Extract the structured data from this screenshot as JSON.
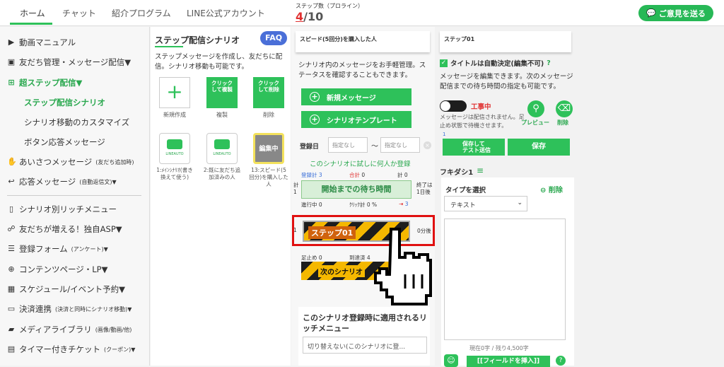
{
  "top_nav": [
    "ホーム",
    "チャット",
    "紹介プログラム",
    "LINE公式アカウント"
  ],
  "step_count": {
    "label": "ステップ数（プロライン）",
    "current": "4",
    "sep": "/",
    "max": "10"
  },
  "feedback_label": "ご意見を送る",
  "sidebar": {
    "items": [
      {
        "label": "動画マニュアル",
        "icon": "video-icon"
      },
      {
        "label": "友だち管理・メッセージ配信▼",
        "icon": "contact-icon"
      },
      {
        "label": "超ステップ配信▼",
        "icon": "hierarchy-icon"
      },
      {
        "label": "ステップ配信シナリオ"
      },
      {
        "label": "シナリオ移動のカスタマイズ"
      },
      {
        "label": "ボタン応答メッセージ"
      },
      {
        "label": "あいさつメッセージ",
        "sub": "(友だち追加時)",
        "icon": "hand-icon"
      },
      {
        "label": "応答メッセージ",
        "sub": "(自動返信文)▼",
        "icon": "reply-icon"
      },
      {
        "label": "シナリオ別リッチメニュー",
        "icon": "phone-icon"
      },
      {
        "label": "友だちが増える！独自ASP▼",
        "icon": "handshake-icon"
      },
      {
        "label": "登録フォーム",
        "sub": "(アンケート)▼",
        "icon": "list-icon"
      },
      {
        "label": "コンテンツページ・LP▼",
        "icon": "globe-icon"
      },
      {
        "label": "スケジュール/イベント予約▼",
        "icon": "calendar-icon"
      },
      {
        "label": "決済連携",
        "sub": "(決済と同時にシナリオ移動)▼",
        "icon": "card-icon"
      },
      {
        "label": "メディアライブラリ",
        "sub": "(画像/動画/他)",
        "icon": "folder-icon"
      },
      {
        "label": "タイマー付きチケット",
        "sub": "(クーポン)▼",
        "icon": "ticket-icon"
      }
    ]
  },
  "scenario": {
    "title": "ステップ配信シナリオ",
    "faq": "FAQ",
    "desc": "ステップメッセージを作成し、友だちに配信。シナリオ移動も可能です。",
    "actions": [
      {
        "btn": "+",
        "label": "新規作成"
      },
      {
        "btn": "クリック\nして複製",
        "label": "複製"
      },
      {
        "btn": "クリック\nして削除",
        "label": "削除"
      }
    ],
    "thumbs": [
      {
        "label": "1:ﾒｲﾝｼﾅﾘｵ(書き換えて使う)",
        "logo": "LINEAUTO"
      },
      {
        "label": "2:既に友だち追加済みの人",
        "logo": "LINEAUTO"
      },
      {
        "label": "13:スピード(5回分)を購入した人",
        "badge": "編集中"
      }
    ]
  },
  "middle": {
    "header": "スピード(5回分)を購入した人",
    "desc": "シナリオ内のメッセージをお手軽管理。ステータスを確認することもできます。",
    "new_msg": "新規メッセージ",
    "template": "シナリオテンプレート",
    "reg_date": "登録日",
    "date_from": "指定なし",
    "date_tilde": "〜",
    "date_to": "指定なし",
    "try_link": "このシナリオに試しに何人か登録",
    "stats1": {
      "reg": "登録計",
      "reg_n": "3",
      "total": "合計",
      "total_n": "0",
      "count": "計",
      "count_n": "0"
    },
    "side": {
      "kei": "計",
      "one": "1",
      "end": "終了は",
      "day": "1日後"
    },
    "wait_btn": "開始までの待ち時間",
    "stats2": {
      "prog": "進行中",
      "prog_n": "0",
      "click": "ｸﾘｯｸ計",
      "click_pct": "0 %",
      "moved_n": "3"
    },
    "step01": "ステップ01",
    "after": "0分後",
    "stats3": {
      "stop": "足止め",
      "stop_n": "0",
      "arrive": "到達済",
      "arrive_n": "4"
    },
    "next_scenario": "次のシナリオ",
    "rich_title": "このシナリオ登録時に適用されるリッチメニュー",
    "rich_select": "切り替えない(このシナリオに登..."
  },
  "right": {
    "header": "ステップ01",
    "title_auto": "タイトルは自動決定(編集不可)",
    "desc": "メッセージを編集できます。次のメッセージ配信までの待ち時間の指定も可能です。",
    "construction": "工事中",
    "note": "メッセージは配信されません。足止め状態で待機させます。",
    "preview": "プレビュー",
    "delete": "削除",
    "person_n": "1",
    "save_test": "保存して\nテスト送信",
    "save": "保存",
    "fukidashi": "フキダシ1",
    "type_label": "タイプを選択",
    "type_delete": "削除",
    "type_value": "テキスト",
    "count_text": "現在0字 / 残り4,500字",
    "field_btn": "[[フィールドを挿入]]"
  },
  "colors": {
    "accent": "#2ec15a",
    "danger": "#e01010",
    "faq": "#4a6fd8"
  }
}
